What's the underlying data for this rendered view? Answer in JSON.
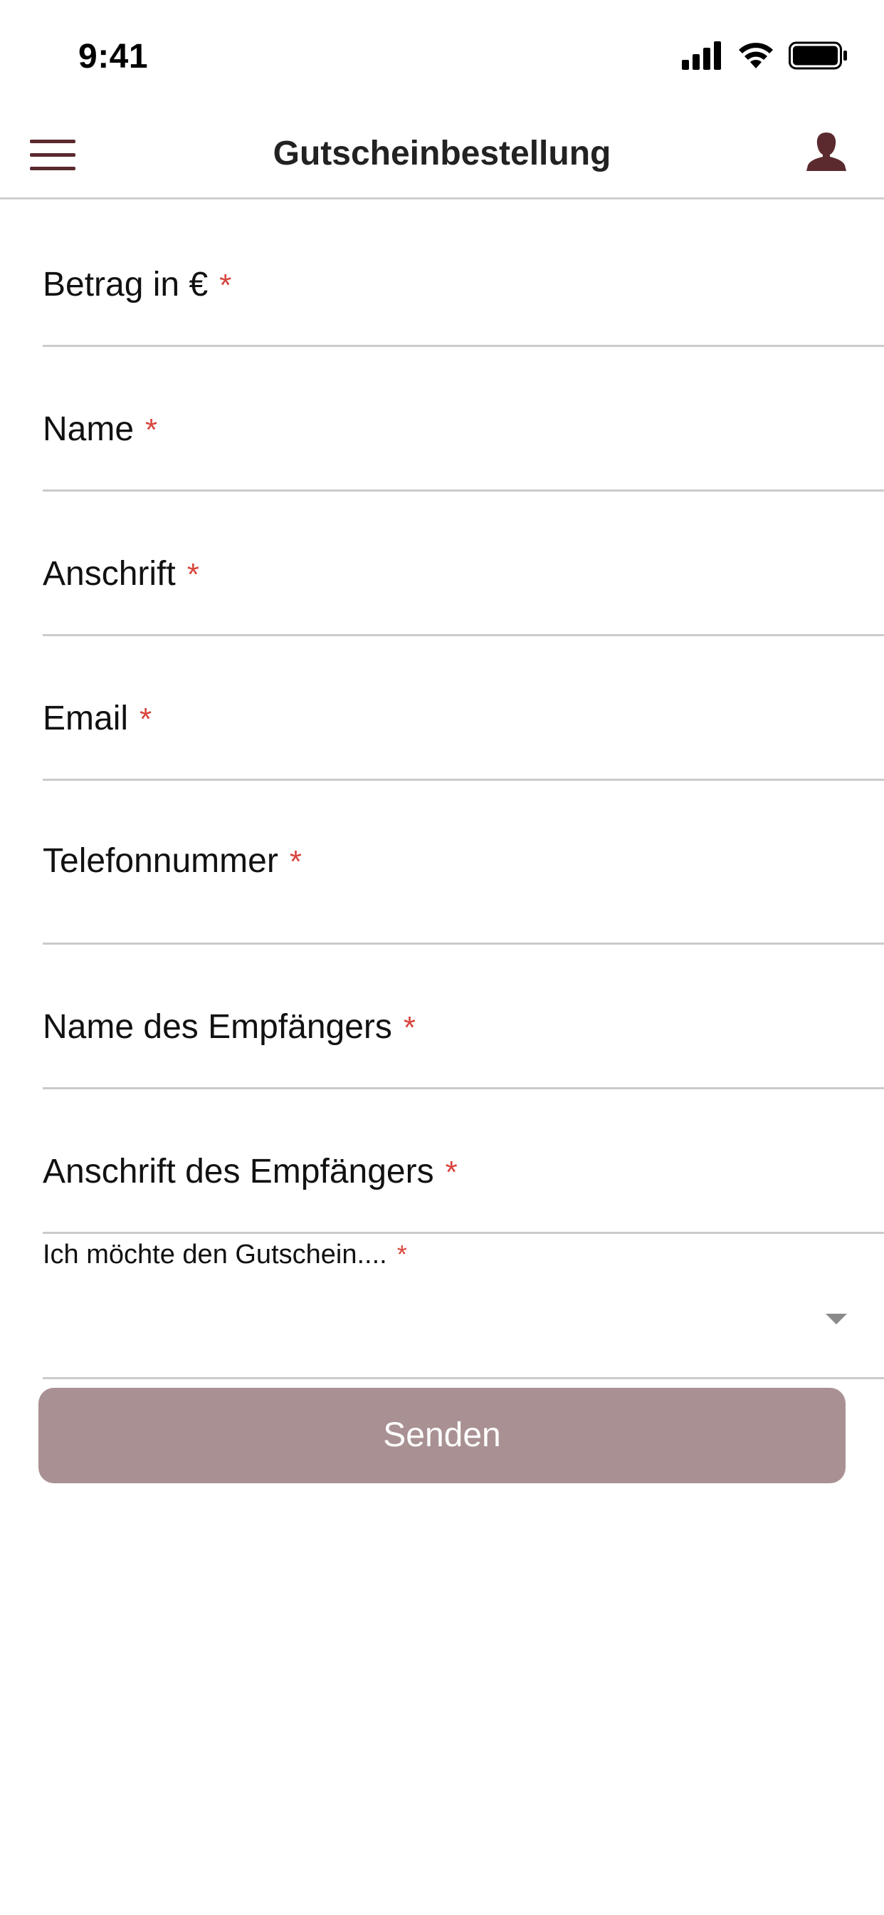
{
  "status_bar": {
    "time": "9:41",
    "icons": [
      "cellular-signal-icon",
      "wifi-icon",
      "battery-icon"
    ]
  },
  "nav": {
    "title": "Gutscheinbestellung",
    "menu_icon": "hamburger-menu-icon",
    "profile_icon": "user-silhouette-icon"
  },
  "form": {
    "required_marker": "*",
    "fields": [
      {
        "label": "Betrag in €",
        "value": ""
      },
      {
        "label": "Name",
        "value": ""
      },
      {
        "label": "Anschrift",
        "value": ""
      },
      {
        "label": "Email",
        "value": ""
      },
      {
        "label": "Telefonnummer",
        "value": ""
      },
      {
        "label": "Name des Empfängers",
        "value": ""
      },
      {
        "label": "Anschrift des Empfängers",
        "value": ""
      }
    ],
    "select": {
      "label": "Ich möchte den Gutschein....",
      "selected": ""
    },
    "submit_label": "Senden"
  },
  "colors": {
    "brand": "#5a2a2e",
    "button": "#a99193",
    "required": "#d9453d",
    "divider": "#cbcbcb"
  }
}
